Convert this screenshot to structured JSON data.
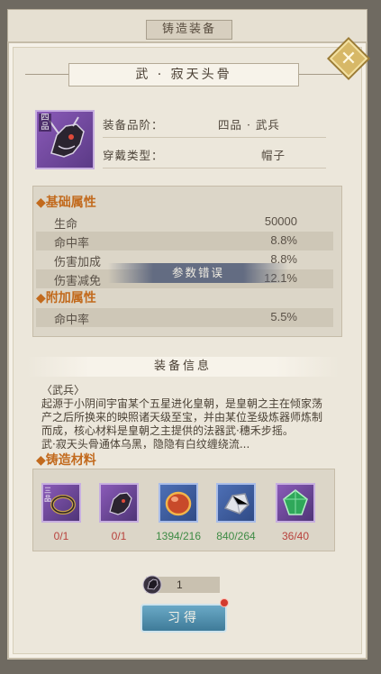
{
  "window": {
    "title": "铸造装备"
  },
  "item": {
    "name": "武 · 寂天头骨",
    "grade_tag": "四品",
    "grade_label": "装备品阶：",
    "grade_value": "四品 · 武兵",
    "type_label": "穿戴类型：",
    "type_value": "帽子"
  },
  "base_section": {
    "title": "◆基础属性",
    "stats": [
      {
        "name": "生命",
        "value": "50000"
      },
      {
        "name": "命中率",
        "value": "8.8%"
      },
      {
        "name": "伤害加成",
        "value": "8.8%"
      },
      {
        "name": "伤害减免",
        "value": "12.1%"
      }
    ]
  },
  "extra_section": {
    "title": "◆附加属性",
    "stats": [
      {
        "name": "命中率",
        "value": "5.5%"
      }
    ]
  },
  "error_message": "参数错误",
  "info": {
    "title": "装备信息",
    "description": "〈武兵〉\n起源于小阴间宇宙某个五星进化皇朝，是皇朝之主在倾家荡产之后所换来的映照诸天级至宝，并由某位圣级炼器师炼制而成，核心材料是皇朝之主提供的法器武·穗禾步摇。\n武·寂天头骨通体乌黑，隐隐有白纹缠绕流..."
  },
  "materials": {
    "title": "◆铸造材料",
    "items": [
      {
        "icon": "bracelet-icon",
        "tag": "三品",
        "count": "0/1",
        "status": "insufficient"
      },
      {
        "icon": "skull-helmet-icon",
        "tag": "",
        "count": "0/1",
        "status": "insufficient"
      },
      {
        "icon": "red-gem-icon",
        "tag": "",
        "count": "1394/216",
        "status": "enough"
      },
      {
        "icon": "silver-ore-icon",
        "tag": "",
        "count": "840/264",
        "status": "enough"
      },
      {
        "icon": "green-gem-icon",
        "tag": "",
        "count": "36/40",
        "status": "insufficient"
      }
    ]
  },
  "quantity": "1",
  "forge_button": "习得",
  "colors": {
    "accent_orange": "#c26a1d",
    "insufficient_red": "#b8413c",
    "enough_green": "#3e8b45",
    "button_blue": "#4f8cab"
  }
}
